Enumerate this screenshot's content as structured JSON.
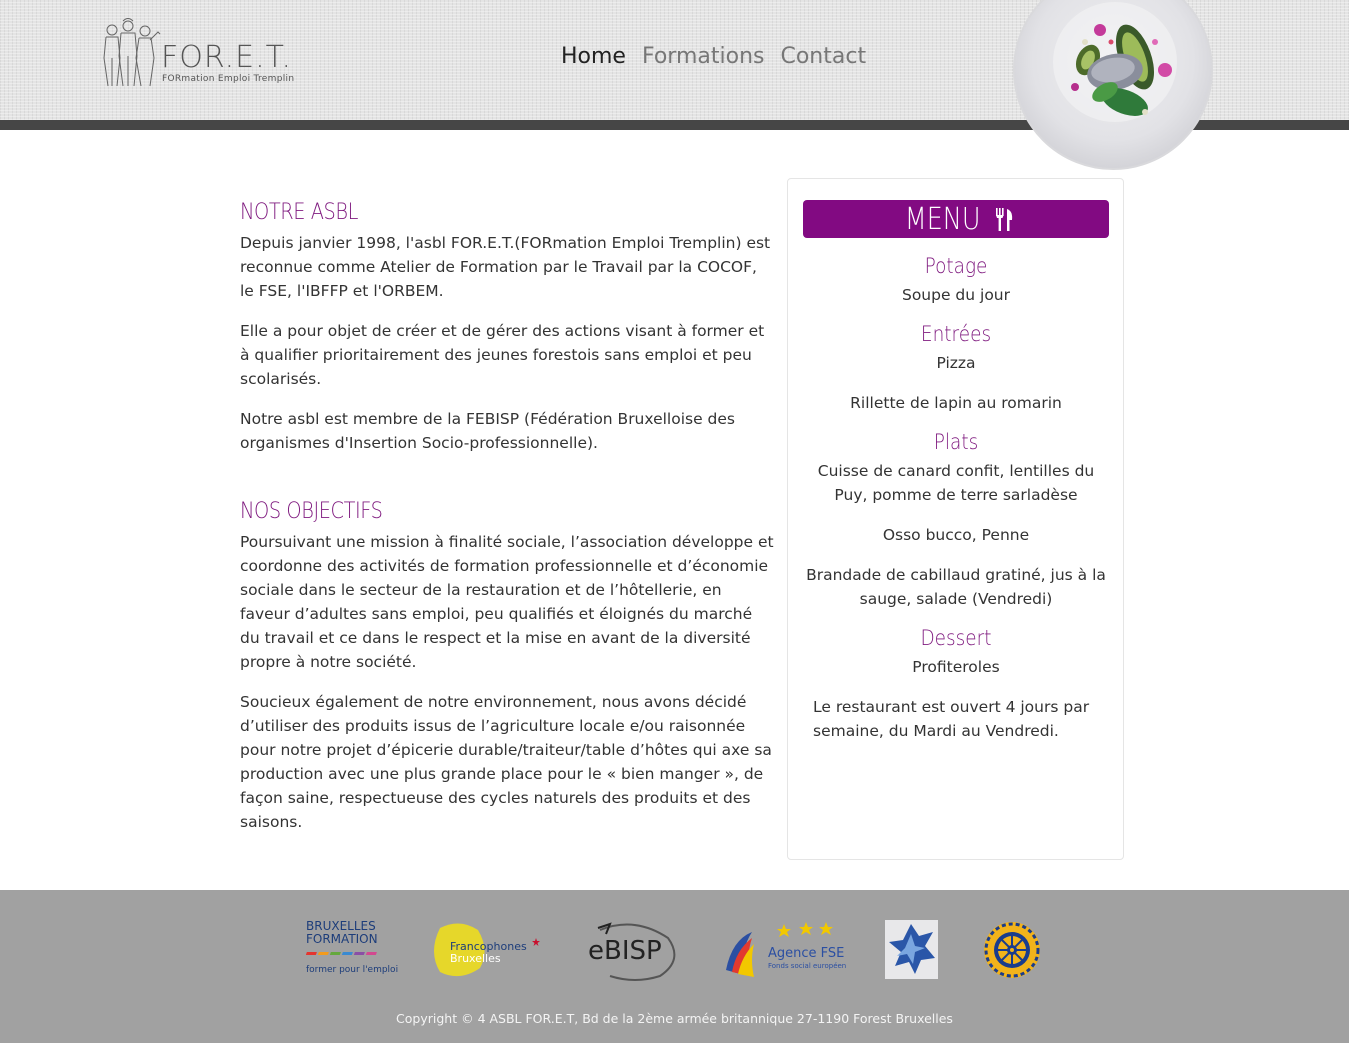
{
  "header": {
    "logo": {
      "title": "FOR.E.T.",
      "subtitle": "FORmation Emploi Tremplin"
    },
    "nav": [
      {
        "label": "Home"
      },
      {
        "label": "Formations"
      },
      {
        "label": "Contact"
      }
    ]
  },
  "main": {
    "section1": {
      "title": "NOTRE ASBL",
      "paragraphs": [
        "Depuis janvier 1998, l'asbl FOR.E.T.(FORmation Emploi Tremplin) est reconnue comme Atelier de Formation par le Travail par la COCOF, le FSE, l'IBFFP et l'ORBEM.",
        "Elle a pour objet de créer et de gérer des actions visant à former et à qualifier prioritairement des jeunes forestois sans emploi et peu scolarisés.",
        "Notre asbl est membre de la FEBISP (Fédération Bruxelloise des organismes d'Insertion Socio-professionnelle)."
      ]
    },
    "section2": {
      "title": "NOS OBJECTIFS",
      "paragraphs": [
        "Poursuivant une mission à finalité sociale, l’association développe et coordonne des activités de formation professionnelle et d’économie sociale dans le secteur de la restauration et de l’hôtellerie, en faveur d’adultes sans emploi, peu qualifiés et éloignés du marché du travail et ce dans le respect et la mise en avant de la diversité propre à notre société.",
        "Soucieux également de notre environnement, nous avons décidé d’utiliser des produits issus de l’agriculture locale e/ou raisonnée pour notre projet d’épicerie durable/traiteur/table d’hôtes qui axe sa production avec une plus grande place pour le « bien manger », de façon saine, respectueuse des cycles naturels des produits et des saisons."
      ]
    }
  },
  "menu": {
    "title": "MENU",
    "icon": "fork-knife-icon",
    "categories": [
      {
        "name": "Potage",
        "items": [
          "Soupe du jour"
        ]
      },
      {
        "name": "Entrées",
        "items": [
          "Pizza",
          "Rillette de lapin au romarin"
        ]
      },
      {
        "name": "Plats",
        "items": [
          "Cuisse de canard confit, lentilles du Puy, pomme de terre sarladèse",
          "Osso bucco, Penne",
          "Brandade de cabillaud gratiné, jus à la sauge, salade (Vendredi)"
        ]
      },
      {
        "name": "Dessert",
        "items": [
          "Profiteroles"
        ]
      }
    ],
    "note": "Le restaurant est ouvert 4 jours par semaine, du Mardi au Vendredi."
  },
  "footer": {
    "partners": {
      "bruxelles_formation": {
        "line1": "BRUXELLES",
        "line2": "FORMATION",
        "tagline": "former pour l'emploi"
      },
      "francophones": {
        "line1": "Francophones",
        "line2": "Bruxelles"
      },
      "febisp": {
        "text": "eBISP"
      },
      "fse": {
        "line1": "Agence FSE",
        "line2": "Fonds social européen"
      }
    },
    "copyright": "Copyright © 4 ASBL FOR.E.T, Bd de la 2ème armée britannique 27-1190 Forest Bruxelles"
  },
  "colors": {
    "accent": "#820a82",
    "header_bar": "#464646",
    "footer_bg": "#a1a1a1"
  }
}
